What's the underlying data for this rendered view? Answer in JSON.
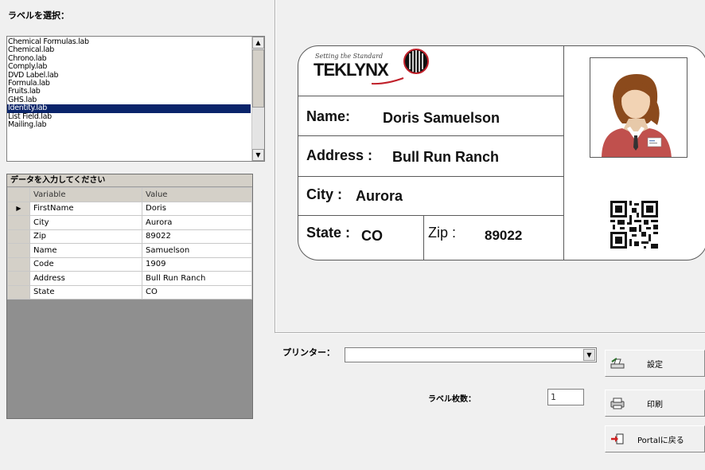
{
  "left": {
    "select_label": "ラベルを選択：",
    "files": [
      "Chemical Formulas.lab",
      "Chemical.lab",
      "Chrono.lab",
      "Comply.lab",
      "DVD Label.lab",
      "Formula.lab",
      "Fruits.lab",
      "GHS.lab",
      "Identity.lab",
      "List Field.lab",
      "Mailing.lab"
    ],
    "selected_file": "Identity.lab",
    "grid": {
      "caption": "データを入力してください",
      "headers": {
        "variable": "Variable",
        "value": "Value"
      },
      "current_row_marker": "▶",
      "rows": [
        {
          "variable": "FirstName",
          "value": "Doris"
        },
        {
          "variable": "City",
          "value": "Aurora"
        },
        {
          "variable": "Zip",
          "value": "89022"
        },
        {
          "variable": "Name",
          "value": "Samuelson"
        },
        {
          "variable": "Code",
          "value": "1909"
        },
        {
          "variable": "Address",
          "value": "Bull Run Ranch"
        },
        {
          "variable": "State",
          "value": "CO"
        }
      ]
    }
  },
  "preview": {
    "brand_tagline": "Setting the Standard",
    "brand_name": "TEKLYNX",
    "name_label": "Name:",
    "name_value": "Doris  Samuelson",
    "address_label": "Address :",
    "address_value": "Bull Run Ranch",
    "city_label": "City :",
    "city_value": "Aurora",
    "state_label": "State :",
    "state_value": "CO",
    "zip_label": "Zip :",
    "zip_value": "89022"
  },
  "controls": {
    "printer_label": "プリンター：",
    "printer_value": "",
    "copies_label": "ラベル枚数：",
    "copies_value": "1",
    "settings_button": "設定",
    "print_button": "印刷",
    "portal_button": "Portalに戻る"
  },
  "colors": {
    "selection": "#0a246a",
    "photo_shirt": "#c0504d",
    "photo_hair": "#8b4a1c"
  }
}
